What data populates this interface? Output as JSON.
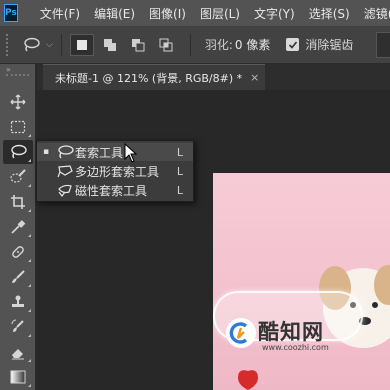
{
  "app": {
    "logo": "Ps"
  },
  "menu": [
    "文件(F)",
    "编辑(E)",
    "图像(I)",
    "图层(L)",
    "文字(Y)",
    "选择(S)",
    "滤镜("
  ],
  "options": {
    "feather_label": "羽化:",
    "feather_value": "0 像素",
    "antialias_label": "消除锯齿",
    "antialias_checked": true
  },
  "toolbar": {
    "collapse_glyph": "»",
    "tools": [
      "move",
      "marquee",
      "lasso",
      "quick-select",
      "crop",
      "eyedropper",
      "healing",
      "brush",
      "stamp",
      "history-brush",
      "eraser",
      "gradient"
    ]
  },
  "document": {
    "tab_title": "未标题-1 @ 121% (背景, RGB/8#) *",
    "close_glyph": "×"
  },
  "flyout": {
    "items": [
      {
        "label": "套索工具",
        "shortcut": "L",
        "selected": true,
        "icon": "lasso-icon"
      },
      {
        "label": "多边形套索工具",
        "shortcut": "L",
        "selected": false,
        "icon": "polygonal-lasso-icon"
      },
      {
        "label": "磁性套索工具",
        "shortcut": "L",
        "selected": false,
        "icon": "magnetic-lasso-icon"
      }
    ],
    "bullet": "▪"
  },
  "watermark": {
    "name": "酷知网",
    "url": "www.coozhi.com"
  },
  "colors": {
    "menubar": "#535353",
    "optionsbar": "#424242",
    "workspace": "#282828",
    "accent_ps": "#31a8ff",
    "canvas_pink": "#f4c4d0"
  }
}
